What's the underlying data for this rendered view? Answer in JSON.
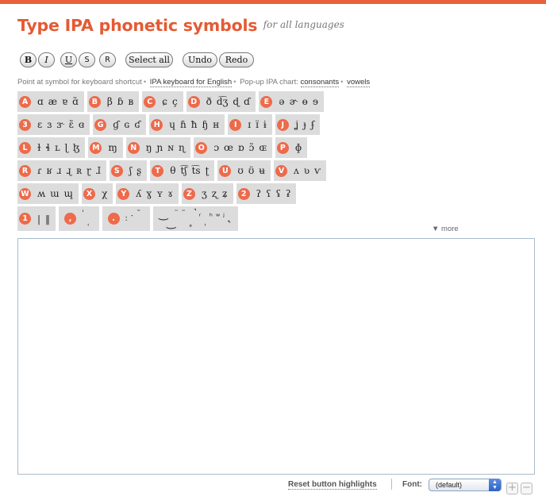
{
  "header": {
    "title": "Type IPA phonetic symbols",
    "subtitle": "for all languages"
  },
  "toolbar": {
    "bold": "B",
    "italic": "I",
    "underline": "U",
    "strike": "S",
    "reset": "R",
    "select_all": "Select all",
    "undo": "Undo",
    "redo": "Redo"
  },
  "info": {
    "hint": "Point at symbol for keyboard shortcut",
    "ipa_keyboard": "IPA keyboard for English",
    "popup": "Pop-up IPA chart:",
    "consonants": "consonants",
    "vowels": "vowels"
  },
  "keyboard": {
    "rows": [
      [
        {
          "key": "A",
          "symbols": [
            "ɑ",
            "æ",
            "ɐ",
            "ɑ̃"
          ]
        },
        {
          "key": "B",
          "symbols": [
            "β",
            "ɓ",
            "ʙ"
          ]
        },
        {
          "key": "C",
          "symbols": [
            "ɕ",
            "ç"
          ]
        },
        {
          "key": "D",
          "symbols": [
            "ð",
            "d͡ʒ",
            "ɖ",
            "ɗ"
          ]
        },
        {
          "key": "E",
          "symbols": [
            "ə",
            "ɚ",
            "ɵ",
            "ɘ"
          ]
        }
      ],
      [
        {
          "key": "3",
          "symbols": [
            "ɛ",
            "ɜ",
            "ɝ",
            "ɛ̃",
            "ɞ"
          ]
        },
        {
          "key": "G",
          "symbols": [
            "ɠ",
            "ɢ",
            "ʛ"
          ]
        },
        {
          "key": "H",
          "symbols": [
            "ɥ",
            "ɦ",
            "ħ",
            "ɧ",
            "ʜ"
          ]
        },
        {
          "key": "I",
          "symbols": [
            "ɪ",
            "ɪ̈",
            "ɨ"
          ]
        },
        {
          "key": "J",
          "symbols": [
            "ʝ",
            "ɟ",
            "ʄ"
          ]
        }
      ],
      [
        {
          "key": "L",
          "symbols": [
            "ɫ",
            "ɬ",
            "ʟ",
            "ɭ",
            "ɮ"
          ]
        },
        {
          "key": "M",
          "symbols": [
            "ɱ"
          ]
        },
        {
          "key": "N",
          "symbols": [
            "ŋ",
            "ɲ",
            "ɴ",
            "ɳ"
          ]
        },
        {
          "key": "O",
          "symbols": [
            "ɔ",
            "œ",
            "ɒ",
            "ɔ̃",
            "ɶ"
          ]
        },
        {
          "key": "P",
          "symbols": [
            "ɸ"
          ]
        }
      ],
      [
        {
          "key": "R",
          "symbols": [
            "ɾ",
            "ʁ",
            "ɹ",
            "ɻ",
            "ʀ",
            "ɽ",
            "ɺ"
          ]
        },
        {
          "key": "S",
          "symbols": [
            "ʃ",
            "ʂ"
          ]
        },
        {
          "key": "T",
          "symbols": [
            "θ",
            "t͡ʃ",
            "t͡s",
            "ʈ"
          ]
        },
        {
          "key": "U",
          "symbols": [
            "ʊ",
            "ʊ̈",
            "ʉ"
          ]
        },
        {
          "key": "V",
          "symbols": [
            "ʌ",
            "ʋ",
            "ⱱ"
          ]
        }
      ],
      [
        {
          "key": "W",
          "symbols": [
            "ʍ",
            "ɯ",
            "ɰ"
          ]
        },
        {
          "key": "X",
          "symbols": [
            "χ"
          ]
        },
        {
          "key": "Y",
          "symbols": [
            "ʎ",
            "ɣ",
            "ʏ",
            "ɤ"
          ]
        },
        {
          "key": "Z",
          "symbols": [
            "ʒ",
            "ʐ",
            "ʑ"
          ]
        },
        {
          "key": "2",
          "symbols": [
            "ʔ",
            "ʕ",
            "ʢ",
            "ʡ"
          ]
        }
      ]
    ],
    "marks_row": {
      "group1": {
        "key": "1",
        "symbols": [
          "|",
          "‖"
        ]
      },
      "group2": {
        "key": ",",
        "symbols": [
          "ˈ",
          "ˌ"
        ]
      },
      "group3": {
        "key": ".",
        "symbols": [
          ":",
          "ˑ",
          "˘"
        ]
      },
      "group4": {
        "symbols": [
          "‿",
          "͜",
          "¨",
          "˜",
          "˳",
          "̚",
          "ʳ",
          "ˌ",
          "ʰ",
          "ʷ",
          "ʲ",
          "˞"
        ]
      }
    },
    "more": "▼ more"
  },
  "footer": {
    "reset_highlights": "Reset button highlights",
    "font_label": "Font:",
    "font_value": "(default)",
    "zoom_in": "+",
    "zoom_out": "−"
  }
}
